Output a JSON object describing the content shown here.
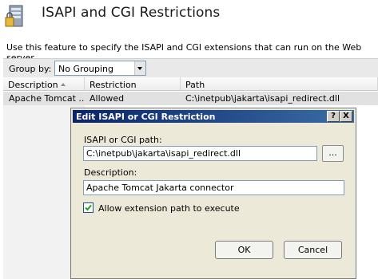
{
  "header": {
    "title": "ISAPI and CGI Restrictions",
    "description": "Use this feature to specify the ISAPI and CGI extensions that can run on the Web server.",
    "icon": "server-lock-icon"
  },
  "toolbar": {
    "group_by_label": "Group by:",
    "group_by_value": "No Grouping"
  },
  "table": {
    "columns": [
      "Description",
      "Restriction",
      "Path"
    ],
    "rows": [
      {
        "description": "Apache Tomcat ...",
        "restriction": "Allowed",
        "path": "C:\\inetpub\\jakarta\\isapi_redirect.dll"
      }
    ]
  },
  "dialog": {
    "title": "Edit ISAPI or CGI Restriction",
    "help_label": "?",
    "close_label": "X",
    "path_label": "ISAPI or CGI path:",
    "path_value": "C:\\inetpub\\jakarta\\isapi_redirect.dll",
    "browse_label": "...",
    "description_label": "Description:",
    "description_value": "Apache Tomcat Jakarta connector",
    "allow_label": "Allow extension path to execute",
    "allow_checked": true,
    "ok_label": "OK",
    "cancel_label": "Cancel"
  },
  "colors": {
    "titlebar_start": "#0a246a",
    "titlebar_end": "#3a6ea5",
    "dialog_bg": "#ece9d8",
    "selected_row": "#e1e1e1"
  }
}
